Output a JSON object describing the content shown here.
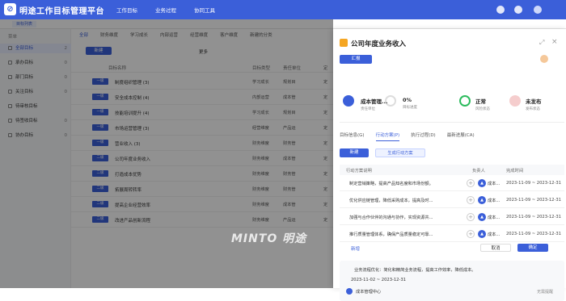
{
  "app": {
    "title": "明途工作目标管理平台",
    "nav": [
      "工作目标",
      "业务过程",
      "协同工具"
    ]
  },
  "tab": {
    "label": "目标列表"
  },
  "sidebar": {
    "header": "菜单",
    "items": [
      {
        "label": "全部目标",
        "count": "2"
      },
      {
        "label": "承办目标",
        "count": "0"
      },
      {
        "label": "部门目标",
        "count": "0"
      },
      {
        "label": "关注目标",
        "count": "0"
      },
      {
        "label": "待审核目标",
        "count": ""
      },
      {
        "label": "待签收目标",
        "count": "0"
      },
      {
        "label": "协办目标",
        "count": "0"
      }
    ]
  },
  "main": {
    "subtabs": [
      "全部",
      "财务维度",
      "学习成长",
      "内部运营",
      "经营维度",
      "客户维度",
      "新建的分类"
    ],
    "new_button": "新建",
    "more": "更多",
    "columns": [
      "目标名称",
      "目标类型",
      "责任单位",
      "定"
    ],
    "rows": [
      {
        "tag": "一级",
        "name": "制度组织管理 (3)",
        "type": "学习成长",
        "unit": "规划目",
        "c4": "定"
      },
      {
        "tag": "一级",
        "name": "安全成本控制 (4)",
        "type": "内部运营",
        "unit": "成本管",
        "c4": "定"
      },
      {
        "tag": "一级",
        "name": "技能培训提升 (4)",
        "type": "学习成长",
        "unit": "规划目",
        "c4": "定"
      },
      {
        "tag": "一级",
        "name": "市场运营管理 (3)",
        "type": "经营维度",
        "unit": "产品运",
        "c4": "定"
      },
      {
        "tag": "一级",
        "name": "营业收入 (3)",
        "type": "财务维度",
        "unit": "财务管",
        "c4": "定"
      },
      {
        "tag": "二级",
        "name": "公司年度业务收入",
        "type": "财务维度",
        "unit": "成本管",
        "c4": "定"
      },
      {
        "tag": "二级",
        "name": "打造成本优势",
        "type": "财务维度",
        "unit": "财务管",
        "c4": "定"
      },
      {
        "tag": "二级",
        "name": "拓展周转转率",
        "type": "财务维度",
        "unit": "财务管",
        "c4": "定"
      },
      {
        "tag": "二级",
        "name": "提高企业经营效率",
        "type": "财务维度",
        "unit": "成本管",
        "c4": "定"
      },
      {
        "tag": "二级",
        "name": "改进产品创新流程",
        "type": "财务维度",
        "unit": "产品运",
        "c4": "定"
      }
    ]
  },
  "panel": {
    "title": "公司年度业务收入",
    "report_button": "汇报",
    "stats": [
      {
        "value": "成本管理...",
        "label": "责任单位"
      },
      {
        "value": "0%",
        "label": "目标进度"
      },
      {
        "value": "正常",
        "label": "风险状态"
      },
      {
        "value": "未发布",
        "label": "发布状态"
      }
    ],
    "tabs": [
      "目标信息(G)",
      "行动方案(P)",
      "执行过程(D)",
      "最新进展(CA)"
    ],
    "new_button": "新建",
    "generate_button": "生成行动方案",
    "table_headers": [
      "行动方案说明",
      "负责人",
      "完成时间"
    ],
    "plans": [
      {
        "desc": "制定营销策略，提高产品知名度和市场份额。",
        "owner": "成本...",
        "date": "2023-11-09 ~ 2023-12-31"
      },
      {
        "desc": "优化供应链管理，降低采购成本，提高及时...",
        "owner": "成本...",
        "date": "2023-11-09 ~ 2023-12-31"
      },
      {
        "desc": "加强与合作伙伴的沟通与协作，实现资源共...",
        "owner": "成本...",
        "date": "2023-11-09 ~ 2023-12-31"
      },
      {
        "desc": "推行质量管理体系，确保产品质量稳定可靠...",
        "owner": "成本...",
        "date": "2023-11-09 ~ 2023-12-31"
      }
    ],
    "add_label": "新增",
    "cancel_button": "取消",
    "confirm_button": "确定",
    "card": {
      "text": "业务流程优化：简化和精简业务流程，提高工作效率，降低成本。",
      "dates": "2023-11-02 ~ 2023-12-31",
      "owner": "成本管理中心",
      "more": "无需提醒"
    }
  },
  "watermark": "MINTO 明途",
  "accent": "#3b5fd9"
}
